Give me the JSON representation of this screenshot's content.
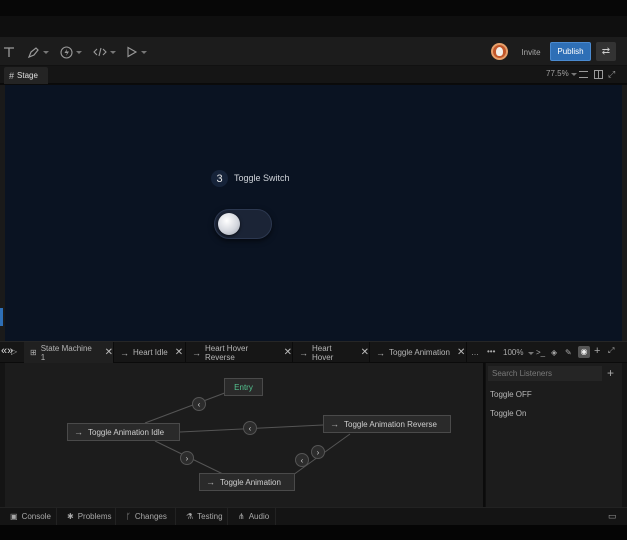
{
  "toolbar": {
    "tools": [
      "text-tool-icon",
      "pen-tool-icon",
      "bolt-icon",
      "code-icon",
      "play-icon"
    ],
    "invite_label": "Invite",
    "publish_label": "Publish",
    "accent_color": "#2e6fb6"
  },
  "stage_bar": {
    "tab_label": "Stage",
    "zoom": "77.5%"
  },
  "stage": {
    "step_number": "3",
    "step_title": "Toggle Switch",
    "background": "#0a1322",
    "toggle_state": "off"
  },
  "sm_tabs": [
    {
      "label": "State Machine 1",
      "icon": "state-machine-icon"
    },
    {
      "label": "Heart Idle",
      "icon": "arrow-icon"
    },
    {
      "label": "Heart Hover Reverse",
      "icon": "arrow-icon"
    },
    {
      "label": "Heart Hover",
      "icon": "arrow-icon"
    },
    {
      "label": "Toggle Animation",
      "icon": "arrow-icon"
    }
  ],
  "sm_bar": {
    "more": "•••",
    "zoom": "100%"
  },
  "graph": {
    "nodes": {
      "entry": "Entry",
      "idle": "Toggle Animation Idle",
      "reverse": "Toggle Animation Reverse",
      "anim": "Toggle Animation"
    }
  },
  "listeners": {
    "search_placeholder": "Search Listeners",
    "items": [
      "Toggle OFF",
      "Toggle On"
    ]
  },
  "bottom_tabs": [
    {
      "label": "Console",
      "icon": "console-icon"
    },
    {
      "label": "Problems",
      "icon": "bug-icon"
    },
    {
      "label": "Changes",
      "icon": "branch-icon"
    },
    {
      "label": "Testing",
      "icon": "flask-icon"
    },
    {
      "label": "Audio",
      "icon": "audio-icon"
    }
  ]
}
